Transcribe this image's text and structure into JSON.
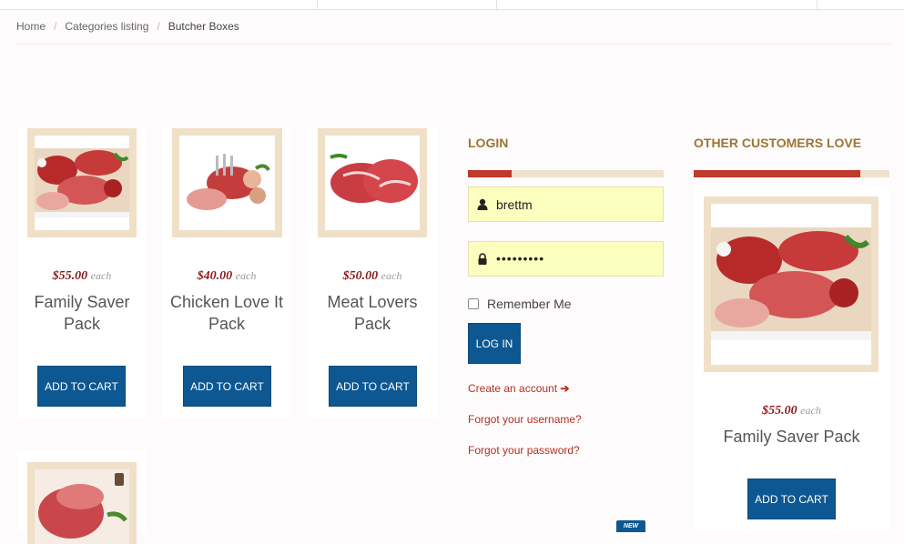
{
  "breadcrumb": {
    "home": "Home",
    "categories": "Categories listing",
    "current": "Butcher Boxes"
  },
  "products": [
    {
      "price": "$55.00",
      "each": "each",
      "name": "Family Saver Pack",
      "button": "ADD TO CART"
    },
    {
      "price": "$40.00",
      "each": "each",
      "name": "Chicken Love It Pack",
      "button": "ADD TO CART"
    },
    {
      "price": "$50.00",
      "each": "each",
      "name": "Meat Lovers Pack",
      "button": "ADD TO CART"
    }
  ],
  "login": {
    "title": "LOGIN",
    "username_value": "brettm",
    "password_value": "•••••••••",
    "remember_label": "Remember Me",
    "login_button": "LOG IN",
    "create_account": "Create an account",
    "forgot_username": "Forgot your username?",
    "forgot_password": "Forgot your password?"
  },
  "other": {
    "title": "OTHER CUSTOMERS LOVE",
    "price": "$55.00",
    "each": "each",
    "name": "Family Saver Pack",
    "button": "ADD TO CART"
  },
  "badge": "NEW",
  "colors": {
    "accent_blue": "#0d5892",
    "price_red": "#8b1a1a",
    "title_gold": "#9b7637",
    "bar_red": "#c0392b",
    "frame_beige": "#f0e0c8",
    "field_yellow": "#fbffbe"
  }
}
